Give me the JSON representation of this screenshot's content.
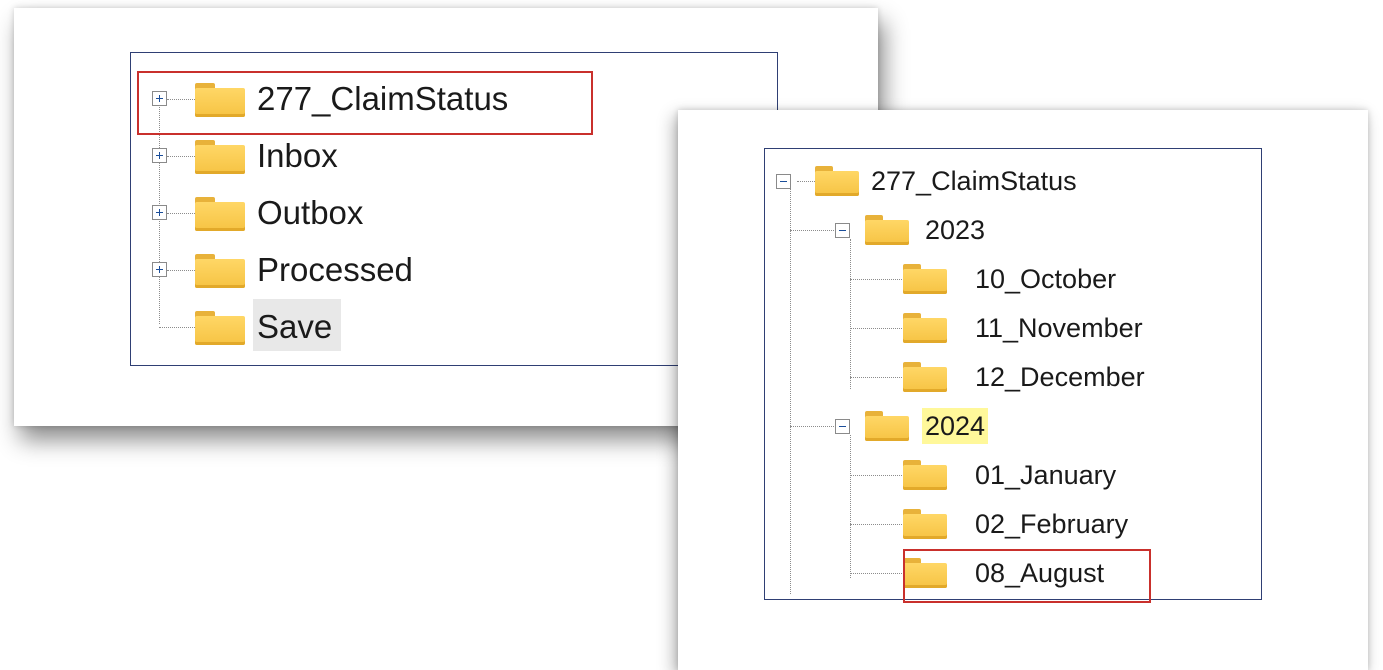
{
  "left_tree": {
    "items": [
      {
        "label": "277_ClaimStatus",
        "expander": "plus",
        "highlight": "red-outline"
      },
      {
        "label": "Inbox",
        "expander": "plus"
      },
      {
        "label": "Outbox",
        "expander": "plus"
      },
      {
        "label": "Processed",
        "expander": "plus"
      },
      {
        "label": "Save",
        "expander": "none",
        "state": "selected-gray"
      }
    ]
  },
  "right_tree": {
    "root": {
      "label": "277_ClaimStatus",
      "expander": "minus"
    },
    "years": [
      {
        "label": "2023",
        "expander": "minus",
        "months": [
          {
            "label": "10_October"
          },
          {
            "label": "11_November"
          },
          {
            "label": "12_December"
          }
        ]
      },
      {
        "label": "2024",
        "expander": "minus",
        "highlight": "yellow",
        "months": [
          {
            "label": "01_January"
          },
          {
            "label": "02_February"
          },
          {
            "label": "08_August",
            "highlight": "red-outline"
          }
        ]
      }
    ]
  },
  "colors": {
    "folder": "#f6c343",
    "tree_border": "#2f3f74",
    "red_outline": "#c9302c",
    "yellow_highlight": "#fff89a",
    "expander_glyph": "#1b4e9a"
  },
  "icons": {
    "folder": "folder-icon",
    "expand": "plus-expander-icon",
    "collapse": "minus-expander-icon"
  }
}
